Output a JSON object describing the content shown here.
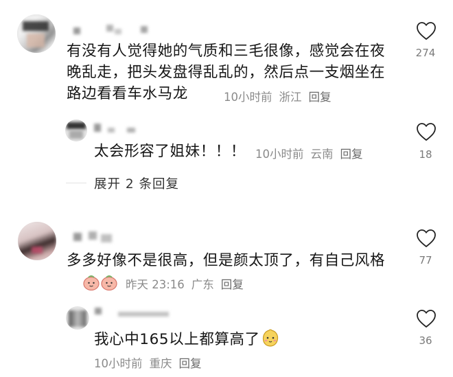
{
  "comments": [
    {
      "text": "有没有人觉得她的气质和三毛很像，感觉会在夜晚乱走，把头发盘得乱乱的，然后点一支烟坐在路边看看车水马龙",
      "time": "10小时前",
      "location": "浙江",
      "reply_label": "回复",
      "likes": "274",
      "replies": [
        {
          "text": "太会形容了姐妹！！！",
          "time": "10小时前",
          "location": "云南",
          "reply_label": "回复",
          "likes": "18"
        }
      ],
      "expand_label": "展开 2 条回复"
    },
    {
      "text": "多多好像不是很高，但是颜太顶了，有自己风格",
      "time": "昨天 23:16",
      "location": "广东",
      "reply_label": "回复",
      "likes": "77",
      "replies": [
        {
          "text": "我心中165以上都算高了",
          "time": "10小时前",
          "location": "重庆",
          "reply_label": "回复",
          "likes": "36"
        }
      ]
    }
  ],
  "icons": {
    "like": "heart-outline-icon"
  },
  "colors": {
    "text": "#161616",
    "meta": "#8a8a8a",
    "icon": "#222222"
  }
}
